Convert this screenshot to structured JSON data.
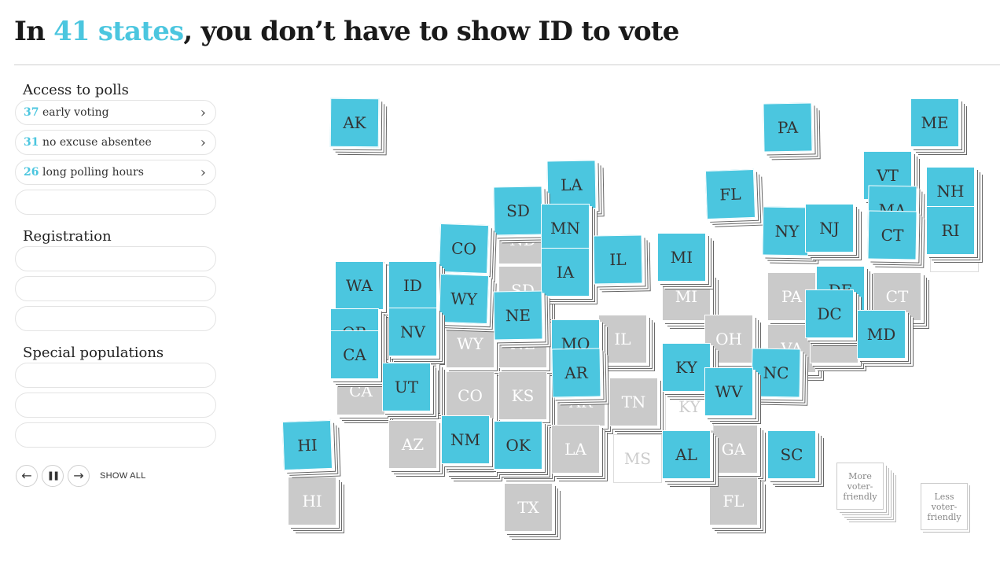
{
  "headline": {
    "prefix": "In ",
    "highlight": "41 states",
    "suffix": ", you don’t have to show ID to vote"
  },
  "colors": {
    "accent": "#4bc6df",
    "tile_grey": "#cacaca"
  },
  "sections": [
    {
      "title": "Access to polls",
      "options": [
        {
          "count": "37",
          "label": "early voting",
          "chevron": "›"
        },
        {
          "count": "31",
          "label": "no excuse absentee",
          "chevron": "›"
        },
        {
          "count": "26",
          "label": "long polling hours",
          "chevron": "›"
        },
        {
          "count": "",
          "label": "",
          "chevron": ""
        }
      ]
    },
    {
      "title": "Registration",
      "options": [
        {
          "count": "",
          "label": "",
          "chevron": ""
        },
        {
          "count": "",
          "label": "",
          "chevron": ""
        },
        {
          "count": "",
          "label": "",
          "chevron": ""
        }
      ]
    },
    {
      "title": "Special populations",
      "options": [
        {
          "count": "",
          "label": "",
          "chevron": ""
        },
        {
          "count": "",
          "label": "",
          "chevron": ""
        },
        {
          "count": "",
          "label": "",
          "chevron": ""
        }
      ]
    }
  ],
  "controls": {
    "prev": "←",
    "pause": "❚❚",
    "next": "→",
    "show_all": "SHOW ALL"
  },
  "tiles": {
    "grey": [
      "ND",
      "SD",
      "WA",
      "OR",
      "ID",
      "WY",
      "NE",
      "CA",
      "NV",
      "UT",
      "CO",
      "KS",
      "AZ",
      "NM",
      "OK",
      "TX",
      "AR",
      "LA",
      "MO",
      "IL",
      "TN",
      "MI",
      "OH",
      "PA",
      "VA",
      "DC",
      "CT",
      "GA",
      "FL",
      "HI",
      "KY",
      "MS"
    ],
    "blue": [
      "AK",
      "PA",
      "ME",
      "LA",
      "FL",
      "VT",
      "NH",
      "MA",
      "SD",
      "MN",
      "NY",
      "NJ",
      "CT",
      "RI",
      "CO",
      "IA",
      "IL",
      "MI",
      "WA",
      "ID",
      "WY",
      "NE",
      "DE",
      "OR",
      "CA",
      "NV",
      "MO",
      "DC",
      "MD",
      "KY",
      "OH",
      "NC",
      "AR",
      "UT",
      "WV",
      "HI",
      "NM",
      "OK",
      "AL",
      "SC"
    ]
  },
  "legend": {
    "more": "More voter-friendly",
    "less": "Less voter-friendly"
  }
}
